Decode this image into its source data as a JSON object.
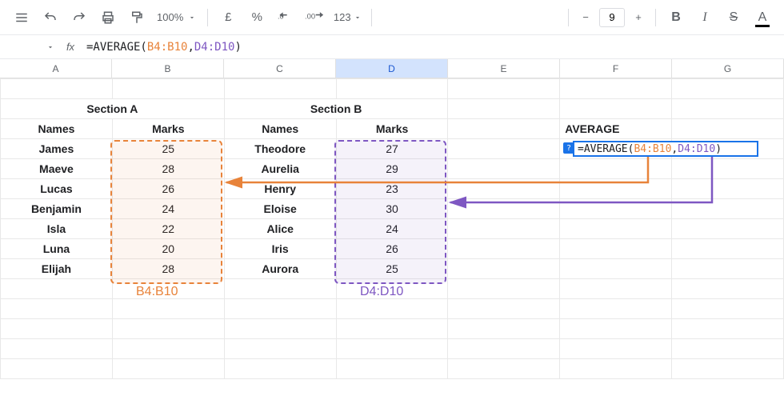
{
  "toolbar": {
    "zoom": "100%",
    "currency": "£",
    "percent": "%",
    "num_fixed": "123",
    "font_size": "9",
    "bold": "B",
    "italic": "I",
    "strike": "S",
    "textcolor": "A"
  },
  "formula_bar": {
    "fx": "fx",
    "prefix": "=AVERAGE(",
    "range1": "B4:B10",
    "comma": ",",
    "range2": "D4:D10",
    "suffix": ")"
  },
  "columns": [
    "A",
    "B",
    "C",
    "D",
    "E",
    "F",
    "G"
  ],
  "sectionA": {
    "title": "Section A",
    "names_hdr": "Names",
    "marks_hdr": "Marks",
    "rows": [
      {
        "name": "James",
        "mark": "25"
      },
      {
        "name": "Maeve",
        "mark": "28"
      },
      {
        "name": "Lucas",
        "mark": "26"
      },
      {
        "name": "Benjamin",
        "mark": "24"
      },
      {
        "name": "Isla",
        "mark": "22"
      },
      {
        "name": "Luna",
        "mark": "20"
      },
      {
        "name": "Elijah",
        "mark": "28"
      }
    ],
    "range_label": "B4:B10"
  },
  "sectionB": {
    "title": "Section B",
    "names_hdr": "Names",
    "marks_hdr": "Marks",
    "rows": [
      {
        "name": "Theodore",
        "mark": "27"
      },
      {
        "name": "Aurelia",
        "mark": "29"
      },
      {
        "name": "Henry",
        "mark": "23"
      },
      {
        "name": "Eloise",
        "mark": "30"
      },
      {
        "name": "Alice",
        "mark": "24"
      },
      {
        "name": "Iris",
        "mark": "26"
      },
      {
        "name": "Aurora",
        "mark": "25"
      }
    ],
    "range_label": "D4:D10"
  },
  "average": {
    "label": "AVERAGE",
    "cell_prefix": "=AVERAGE(",
    "cell_r1": "B4:B10",
    "cell_comma": ",",
    "cell_r2": "D4:D10",
    "cell_suffix": ")"
  },
  "help_badge": "?"
}
